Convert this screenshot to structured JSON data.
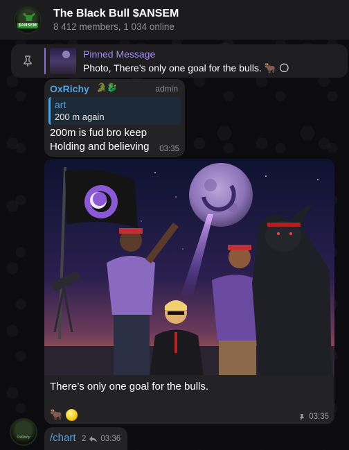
{
  "chat": {
    "title": "The Black Bull $ANSEM",
    "subtitle": "8 412 members, 1 034 online",
    "avatar_tag": "$ANSEM"
  },
  "pinned": {
    "title": "Pinned Message",
    "body": "Photo, There’s only one goal for the bulls. 🐂 🌕"
  },
  "messages": [
    {
      "sender": "OxRichy",
      "badges": "🐊🐉",
      "role": "admin",
      "reply": {
        "name": "art",
        "text": "200 m again"
      },
      "text": "200m is fud bro keep Holding and believing",
      "time": "03:35"
    },
    {
      "caption": "There’s only one goal for the bulls.",
      "reaction_1": "🐂",
      "time": "03:35"
    },
    {
      "text": "/chart",
      "replies": "2",
      "time": "03:36",
      "avatar_tag": "OxRichy"
    }
  ],
  "colors": {
    "accent": "#4fa3e3",
    "pinned_accent": "#a68ef0",
    "bubble": "#232325",
    "header": "#1c1c1e"
  }
}
